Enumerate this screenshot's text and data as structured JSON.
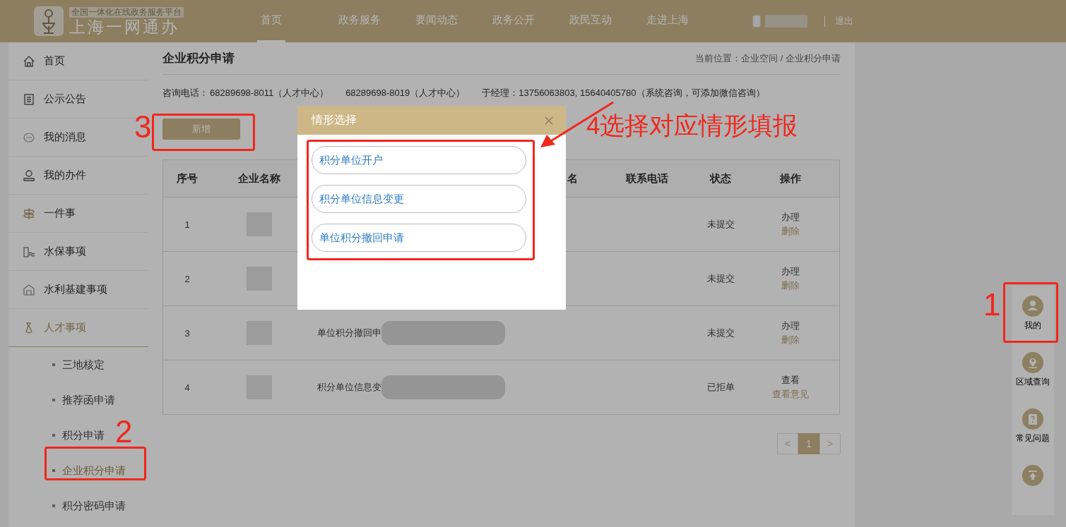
{
  "header": {
    "logo_subtitle": "全国一体化在线政务服务平台",
    "logo_title": "上海一网通办",
    "nav": [
      {
        "label": "首页",
        "selected": true
      },
      {
        "label": "政务服务",
        "selected": false
      },
      {
        "label": "要闻动态",
        "selected": false
      },
      {
        "label": "政务公开",
        "selected": false
      },
      {
        "label": "政民互动",
        "selected": false
      },
      {
        "label": "走进上海",
        "selected": false
      }
    ],
    "logout": "退出"
  },
  "sidebar": {
    "items": [
      {
        "label": "首页",
        "expanded": false
      },
      {
        "label": "公示公告",
        "expanded": false
      },
      {
        "label": "我的消息",
        "expanded": false
      },
      {
        "label": "我的办件",
        "expanded": false
      },
      {
        "label": "一件事",
        "expanded": false
      },
      {
        "label": "水保事项",
        "expanded": false
      },
      {
        "label": "水利基建事项",
        "expanded": false
      },
      {
        "label": "人才事项",
        "expanded": true,
        "children": [
          {
            "label": "三地核定",
            "selected": false
          },
          {
            "label": "推荐函申请",
            "selected": false
          },
          {
            "label": "积分申请",
            "selected": false
          },
          {
            "label": "企业积分申请",
            "selected": true
          },
          {
            "label": "积分密码申请",
            "selected": false
          }
        ]
      }
    ]
  },
  "page": {
    "title": "企业积分申请",
    "breadcrumb": "当前位置：企业空间 / 企业积分申请",
    "contacts": [
      "咨询电话：",
      "68289698-8011（人才中心）",
      "68289698-8019（人才中心）",
      "于经理：13756063803, 15640405780（系统咨询，可添加微信咨询）"
    ],
    "add_button": "新增"
  },
  "table": {
    "columns": [
      "序号",
      "企业名称",
      "",
      "名",
      "联系电话",
      "状态",
      "操作"
    ],
    "rows": [
      {
        "no": "1",
        "status": "未提交",
        "actions": [
          "办理",
          "删除"
        ]
      },
      {
        "no": "2",
        "status": "未提交",
        "actions": [
          "办理",
          "删除"
        ]
      },
      {
        "no": "3",
        "type": "单位积分撤回申",
        "status": "未提交",
        "actions": [
          "办理",
          "删除"
        ]
      },
      {
        "no": "4",
        "type": "积分单位信息变",
        "status": "已拒单",
        "actions": [
          "查看",
          "查看意见"
        ]
      }
    ]
  },
  "pagination": [
    {
      "label": "<",
      "selected": false
    },
    {
      "label": "1",
      "selected": true
    },
    {
      "label": ">",
      "selected": false
    }
  ],
  "float_tools": [
    {
      "label": "我的"
    },
    {
      "label": "区域查询"
    },
    {
      "label": "常见问题"
    }
  ],
  "dialog": {
    "title": "情形选择",
    "options": [
      "积分单位开户",
      "积分单位信息变更",
      "单位积分撤回申请"
    ]
  },
  "annotations": [
    "3",
    "2",
    "1",
    "4选择对应情形填报"
  ]
}
